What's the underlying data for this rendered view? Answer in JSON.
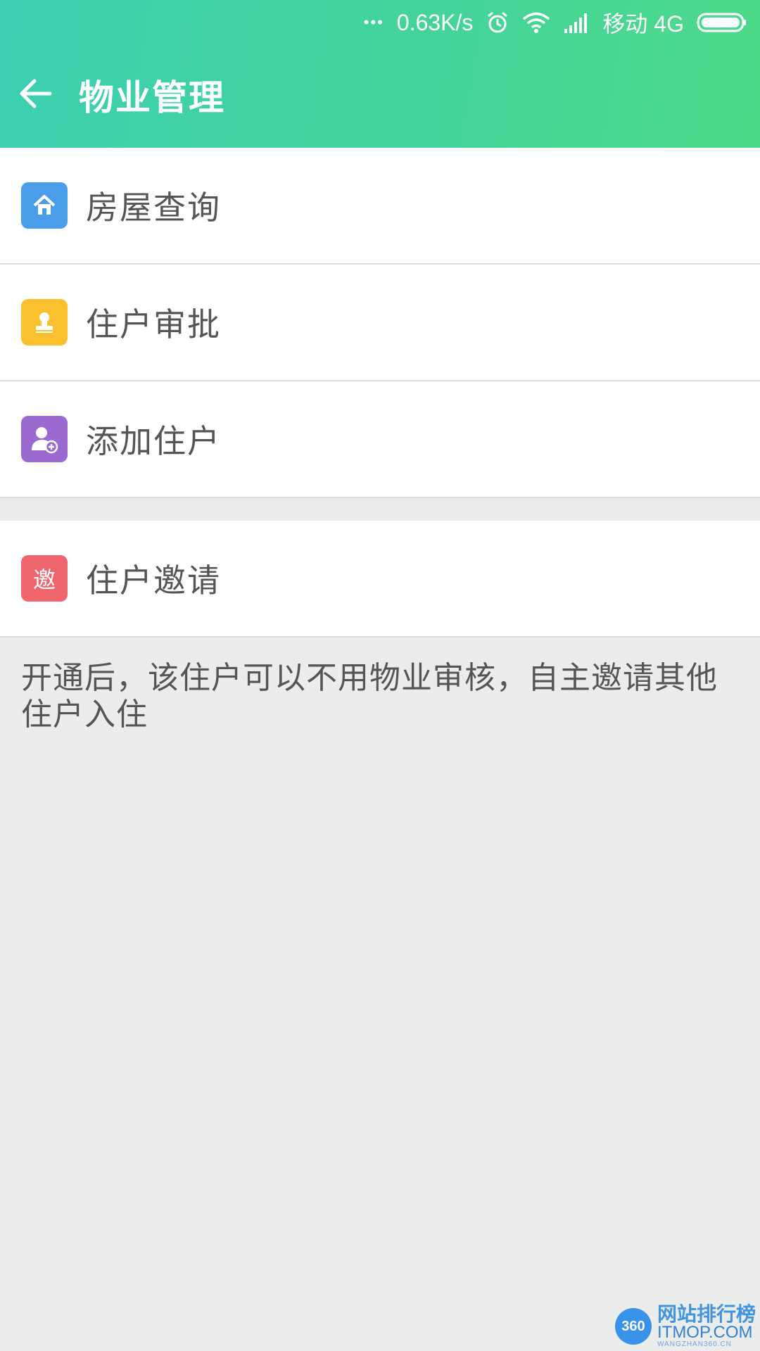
{
  "status_bar": {
    "dots": "•••",
    "speed": "0.63K/s",
    "carrier": "移动 4G",
    "icons": [
      "more-dots-icon",
      "alarm-icon",
      "wifi-icon",
      "signal-icon",
      "battery-icon"
    ]
  },
  "header": {
    "title": "物业管理",
    "back_icon": "arrow-left-icon",
    "gradient_colors": [
      "#3ccfb2",
      "#4ed98a"
    ]
  },
  "menu": {
    "group1": [
      {
        "label": "房屋查询",
        "icon": "house-icon",
        "color": "#4a9de9"
      },
      {
        "label": "住户审批",
        "icon": "stamp-icon",
        "color": "#fbc02d"
      },
      {
        "label": "添加住户",
        "icon": "add-person-icon",
        "color": "#9b6ad0"
      }
    ],
    "group2": [
      {
        "label": "住户邀请",
        "icon_text": "邀",
        "icon": "invite-icon",
        "color": "#f0646e"
      }
    ]
  },
  "note": "开通后，该住户可以不用物业审核，自主邀请其他住户入住",
  "watermark": {
    "logo": "360",
    "main": "网站排行榜",
    "sub": "ITMOP.COM",
    "tiny": "WANGZHAN360.CN"
  }
}
